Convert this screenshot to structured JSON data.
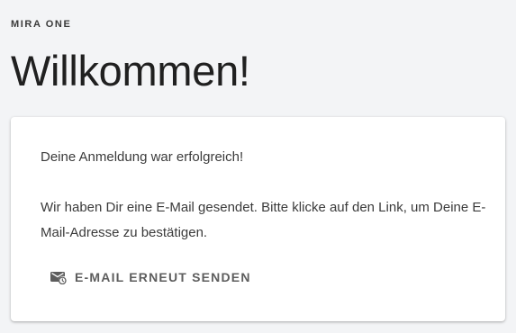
{
  "brand": "MIRA ONE",
  "heading": "Willkommen!",
  "card": {
    "message_success": "Deine Anmeldung war erfolgreich!",
    "message_instructions": "Wir haben Dir eine E-Mail gesendet. Bitte klicke auf den Link, um Deine E-Mail-Adresse zu bestätigen.",
    "resend_button": {
      "label": "E-MAIL ERNEUT SENDEN",
      "icon": "mail-schedule-icon"
    }
  },
  "colors": {
    "page_background": "#f3f4f6",
    "card_background": "#ffffff",
    "button_text": "#5d5d5d"
  }
}
